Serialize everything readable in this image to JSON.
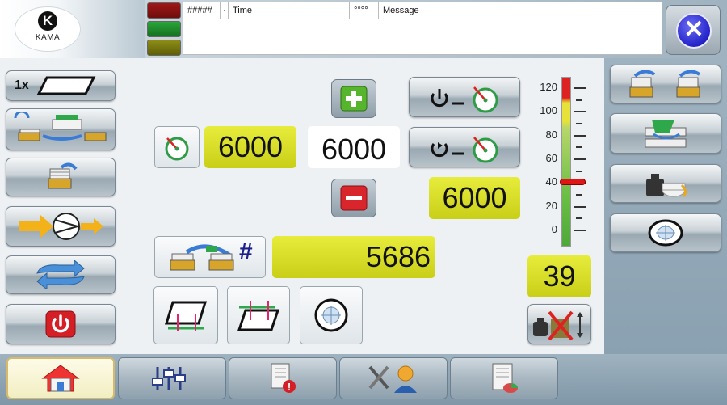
{
  "header": {
    "logo_letter": "K",
    "logo_name": "KAMA",
    "status_leds": [
      {
        "color": "#8a1111",
        "state": "red"
      },
      {
        "color": "#1f8a2a",
        "state": "green"
      },
      {
        "color": "#7a7a10",
        "state": "olive"
      }
    ],
    "message_table": {
      "columns": [
        "#####",
        "·",
        "Time",
        "°°°°",
        "Message"
      ]
    },
    "close_icon": "close-icon"
  },
  "left_toolbar": {
    "multiplier_label": "1x",
    "buttons": [
      {
        "name": "sheet-size-button",
        "icon": "sheet-outline-icon"
      },
      {
        "name": "stack-transfer-button",
        "icon": "stack-transfer-icon"
      },
      {
        "name": "stack-feed-button",
        "icon": "stack-feed-icon"
      },
      {
        "name": "pump-button",
        "icon": "pump-arrow-icon"
      },
      {
        "name": "cycle-button",
        "icon": "rotate-arrows-icon"
      },
      {
        "name": "power-button",
        "icon": "power-icon"
      }
    ]
  },
  "speed": {
    "set_value": "6000",
    "display_value": "6000",
    "actual_value": "6000",
    "increase_icon": "plus-icon",
    "decrease_icon": "minus-icon"
  },
  "counter": {
    "value": "5686",
    "hash": "#"
  },
  "scale": {
    "labels": [
      "120",
      "100",
      "80",
      "60",
      "40",
      "20",
      "0"
    ],
    "indicator_value": 40,
    "max": 120,
    "readout": "39"
  },
  "right_toolbar": {
    "buttons": [
      {
        "name": "stack-exchange-button",
        "icon": "stack-exchange-icon"
      },
      {
        "name": "sheet-separation-button",
        "icon": "sheet-separation-icon"
      },
      {
        "name": "weight-button",
        "icon": "weight-icon"
      },
      {
        "name": "target-button",
        "icon": "target-icon"
      }
    ]
  },
  "bottom_tabs": [
    {
      "name": "tab-home",
      "icon": "home-icon",
      "active": true
    },
    {
      "name": "tab-settings",
      "icon": "sliders-icon",
      "active": false
    },
    {
      "name": "tab-alarms",
      "icon": "alarm-document-icon",
      "active": false
    },
    {
      "name": "tab-service",
      "icon": "tools-user-icon",
      "active": false
    },
    {
      "name": "tab-reports",
      "icon": "report-chart-icon",
      "active": false
    }
  ]
}
